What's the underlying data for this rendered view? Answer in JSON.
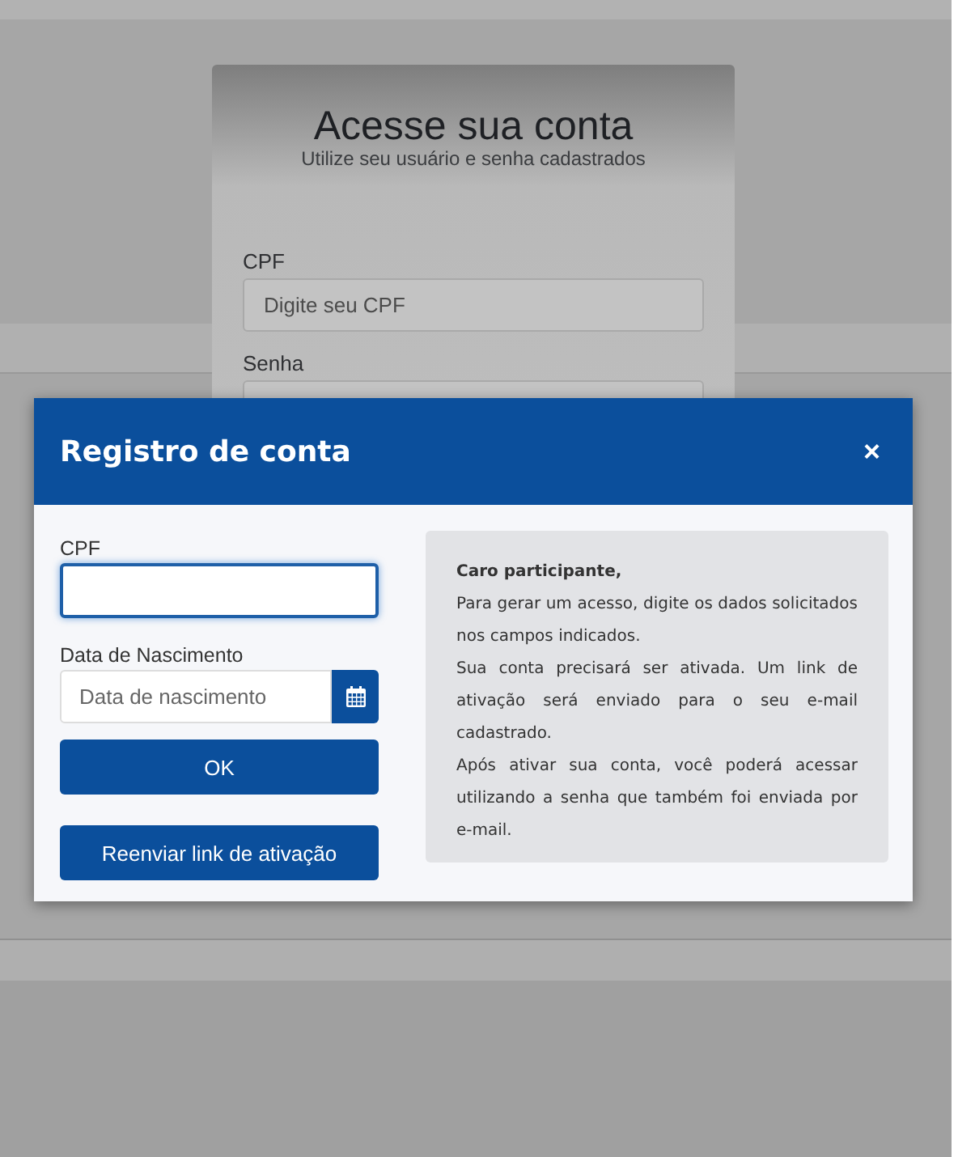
{
  "login": {
    "title": "Acesse sua conta",
    "subtitle": "Utilize seu usuário e senha cadastrados",
    "fields": [
      {
        "label": "CPF",
        "placeholder": "Digite seu CPF"
      },
      {
        "label": "Senha"
      }
    ]
  },
  "modal": {
    "title": "Registro de conta",
    "close": "×",
    "fields": [
      {
        "kind": "text",
        "label": "CPF",
        "focused": true
      },
      {
        "kind": "date",
        "label": "Data de Nascimento",
        "placeholder": "Data de nascimento",
        "focused": false
      }
    ],
    "buttons": [
      "OK",
      "Reenviar link de ativação"
    ],
    "info": {
      "heading": "Caro participante,",
      "paragraphs": [
        "Para gerar um acesso, digite os dados solicitados nos campos indicados.",
        "Sua conta precisará ser ativada. Um link de ativação será enviado para o seu e-mail cadastrado.",
        "Após ativar sua conta, você poderá acessar utilizando a senha que também foi enviada por e-mail."
      ]
    }
  }
}
